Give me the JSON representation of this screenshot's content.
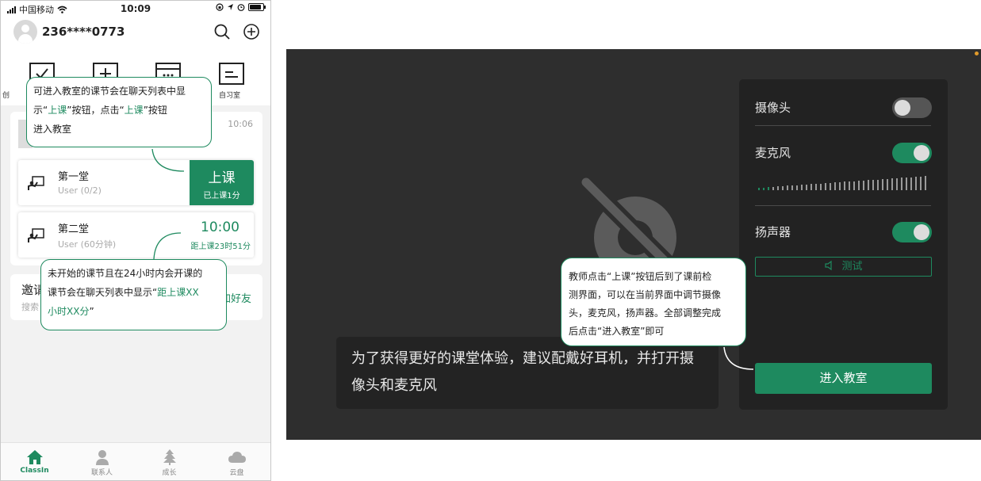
{
  "phone": {
    "status": {
      "carrier": "中国移动",
      "time": "10:09"
    },
    "header": {
      "user_phone": "236****0773"
    },
    "quick_actions": {
      "study_room_label": "自习室",
      "first_label_partial": "创"
    },
    "chat": {
      "time": "10:06"
    },
    "lessons": [
      {
        "name": "第一堂",
        "users": "User (0/2)",
        "button_label": "上课",
        "button_sub": "已上课1分"
      },
      {
        "name": "第二堂",
        "users": "User (60分钟)",
        "countdown_time": "10:00",
        "countdown_sub": "距上课23时51分"
      }
    ],
    "invite": {
      "title": "邀请",
      "subtitle": "搜索",
      "right": "加好友"
    },
    "tabs": [
      {
        "label": "ClassIn",
        "icon": "home-icon",
        "active": true
      },
      {
        "label": "联系人",
        "icon": "contacts-icon"
      },
      {
        "label": "成长",
        "icon": "tree-icon"
      },
      {
        "label": "云盘",
        "icon": "cloud-icon"
      }
    ],
    "callout1": {
      "l1": "可进入教室的课节会在聊天列表中显",
      "l2a": "示“",
      "l2b": "上课",
      "l2c": "”按钮，点击“",
      "l2d": "上课",
      "l2e": "”按钮",
      "l3": "进入教室"
    },
    "callout2": {
      "l1": "未开始的课节且在24小时内会开课的",
      "l2a": "课节会在聊天列表中显示“",
      "l2b": "距上课XX",
      "l3a": "小时XX分",
      "l3b": "”"
    }
  },
  "device_check": {
    "camera_label": "摄像头",
    "mic_label": "麦克风",
    "speaker_label": "扬声器",
    "camera_on": false,
    "mic_on": true,
    "speaker_on": true,
    "mic_level_fraction": 0.08,
    "test_label": "测试",
    "enter_label": "进入教室",
    "tip_line1": "为了获得更好的课堂体验，建议配戴好耳机，并打开摄",
    "tip_line2": "像头和麦克风",
    "callout": {
      "l1": "教师点击“上课”按钮后到了课前检",
      "l2": "测界面，可以在当前界面中调节摄像",
      "l3": "头，麦克风，扬声器。全部调整完成",
      "l4": "后点击“进入教室”即可"
    },
    "colors": {
      "accent": "#1e8a5f",
      "stage": "#2e2e2e",
      "panel": "#222222"
    }
  }
}
